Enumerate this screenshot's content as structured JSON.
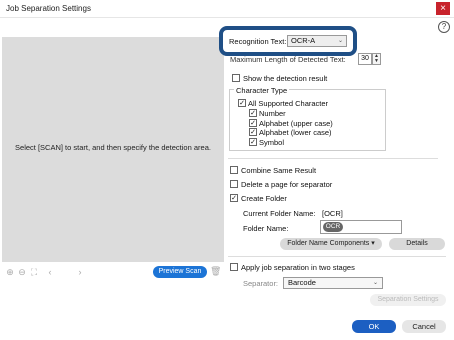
{
  "window": {
    "title": "Job Separation Settings",
    "close_glyph": "×",
    "help_glyph": "?"
  },
  "preview": {
    "message": "Select [SCAN] to start, and then specify the detection area.",
    "tools": [
      "zoom-in-icon",
      "zoom-out-icon",
      "fit-icon",
      "prev-icon",
      "next-icon"
    ],
    "preview_scan_label": "Preview Scan"
  },
  "settings": {
    "recognition_text_label": "Recognition Text:",
    "recognition_text_value": "OCR-A",
    "max_length_label": "Maximum Length of Detected Text:",
    "max_length_value": "30",
    "show_detection_label": "Show the detection result",
    "show_detection_checked": false,
    "character_type": {
      "title": "Character Type",
      "all_label": "All Supported Character",
      "items": [
        {
          "label": "Number",
          "checked": true
        },
        {
          "label": "Alphabet (upper case)",
          "checked": true
        },
        {
          "label": "Alphabet (lower case)",
          "checked": true
        },
        {
          "label": "Symbol",
          "checked": true
        }
      ]
    },
    "combine_label": "Combine Same Result",
    "delete_page_label": "Delete a page for separator",
    "create_folder_label": "Create Folder",
    "current_folder_label": "Current Folder Name:",
    "current_folder_value": "[OCR]",
    "folder_name_label": "Folder Name:",
    "folder_name_chip": "OCR",
    "folder_components_label": "Folder Name Components",
    "details_label": "Details",
    "two_stages_label": "Apply job separation in two stages",
    "separator_label": "Separator:",
    "separator_value": "Barcode",
    "separation_settings_label": "Separation Settings"
  },
  "footer": {
    "ok_label": "OK",
    "cancel_label": "Cancel"
  },
  "colors": {
    "accent": "#1c74d6",
    "ok": "#1c5fc2",
    "callout": "#1f4f86",
    "close": "#c8232c"
  }
}
